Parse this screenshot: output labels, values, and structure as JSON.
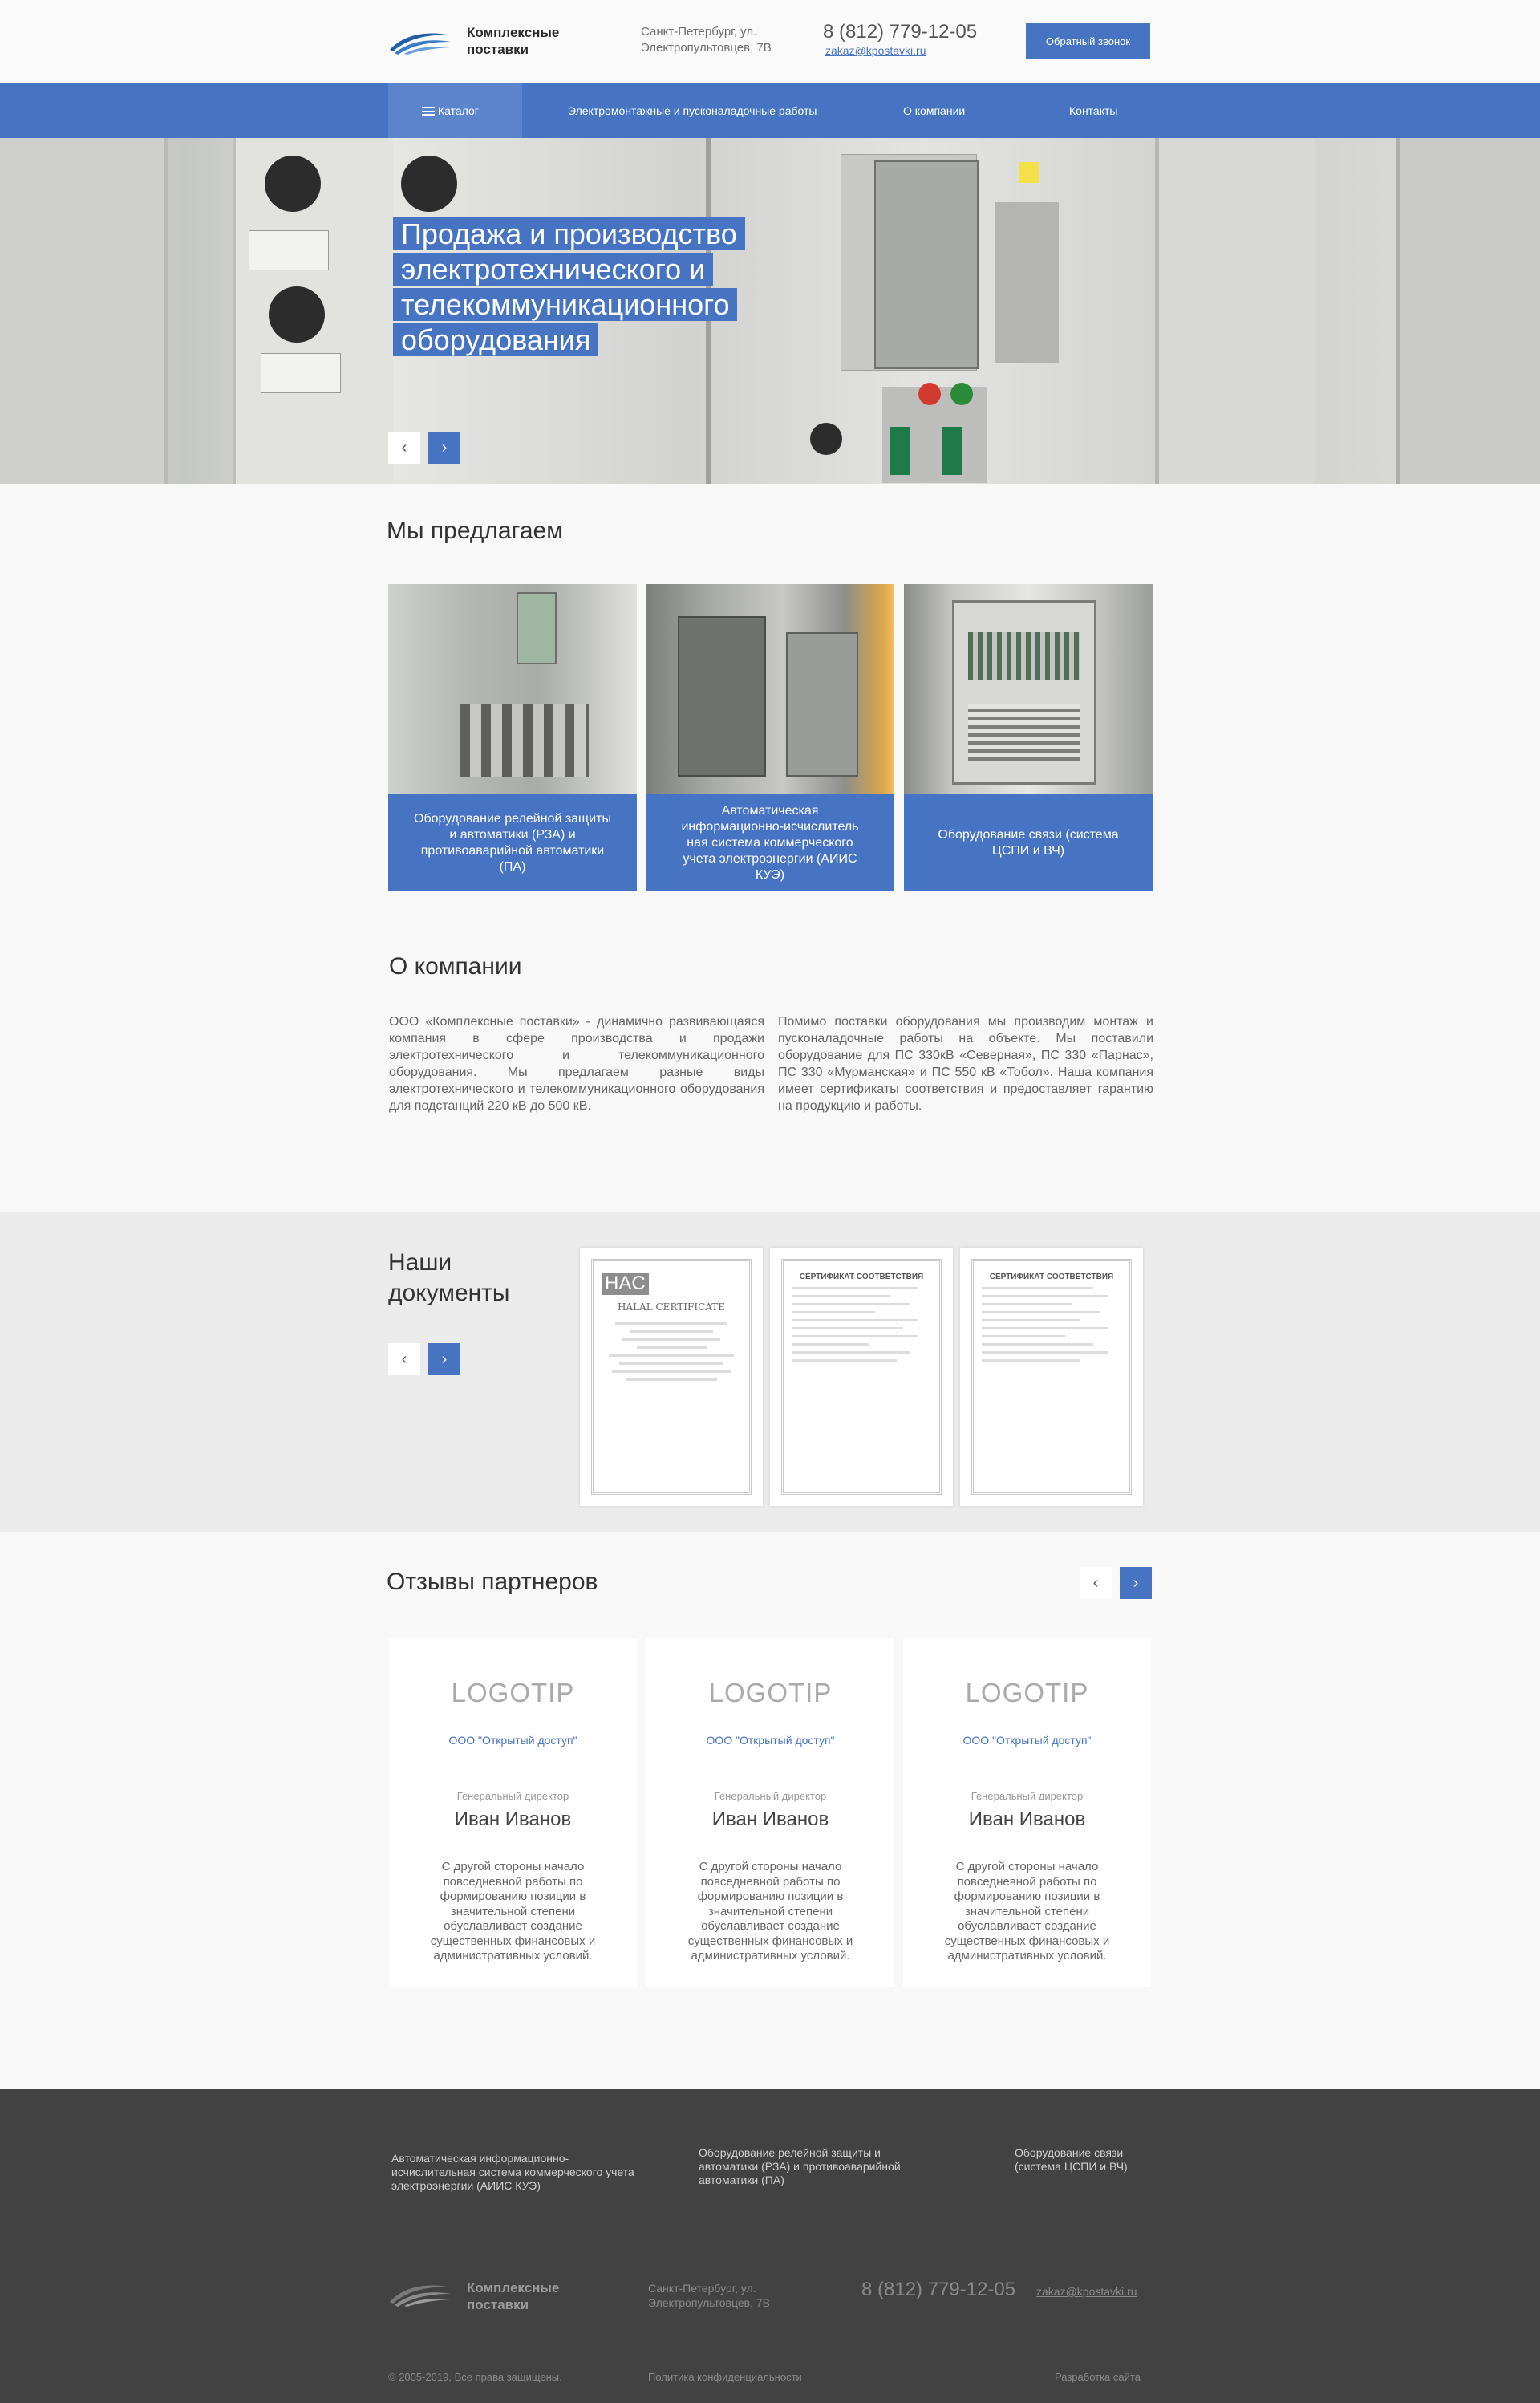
{
  "header": {
    "logo_name": "Комплексные поставки",
    "address": "Санкт-Петербург, ул. Электропультовцев, 7В",
    "phone": "8 (812) 779-12-05",
    "email": "zakaz@kpostavki.ru",
    "callback_label": "Обратный звонок"
  },
  "nav": {
    "catalog": "Каталог",
    "items": [
      "Электромонтажные и пусконаладочные работы",
      "О компании",
      "Контакты"
    ]
  },
  "hero": {
    "title_lines": [
      "Продажа и производство",
      "электротехнического и",
      "телекоммуникационного",
      "оборудования"
    ],
    "prev": "‹",
    "next": "›"
  },
  "offers": {
    "title": "Мы предлагаем",
    "items": [
      "Оборудование релейной защиты и автоматики (РЗА) и противоаварийной автоматики (ПА)",
      "Автоматическая информационно-исчислитель ная система коммерческого учета электроэнергии (АИИС КУЭ)",
      "Оборудование связи (системa ЦСПИ и ВЧ)"
    ]
  },
  "about": {
    "title": "О компании",
    "col1": "ООО «Комплексные поставки» - динамично развивающаяся компания в сфере производства и продажи электротехнического и телекоммуникационного оборудования. Мы предлагаем разные виды электротехнического и телекоммуникационного оборудования для подстанций 220 кВ до 500 кВ.",
    "col2": "Помимо поставки оборудования мы производим монтаж и пусконаладочные работы на объекте. Мы поставили оборудование для ПС 330кВ «Северная», ПС 330 «Парнас», ПС 330 «Мурманская» и ПС 550 кВ «Тобол». Наша компания имеет сертификаты соответствия и предоставляет гарантию на продукцию и работы."
  },
  "documents": {
    "title_line1": "Наши",
    "title_line2": "документы",
    "certs": [
      {
        "badge": "HAC",
        "heading": "HALAL CERTIFICATE"
      },
      {
        "badge": "",
        "heading": "СЕРТИФИКАТ СООТВЕТСТВИЯ"
      },
      {
        "badge": "",
        "heading": "СЕРТИФИКАТ СООТВЕТСТВИЯ"
      }
    ]
  },
  "reviews": {
    "title": "Отзывы партнеров",
    "items": [
      {
        "logo": "LOGOTIP",
        "company": "ООО \"Открытый доступ\"",
        "role": "Генеральный директор",
        "name": "Иван Иванов",
        "text": "С другой стороны начало повседневной работы по формированию позиции в значительной степени обуславливает создание существенных финансовых и административных условий."
      },
      {
        "logo": "LOGOTIP",
        "company": "ООО \"Открытый доступ\"",
        "role": "Генеральный директор",
        "name": "Иван Иванов",
        "text": "С другой стороны начало повседневной работы по формированию позиции в значительной степени обуславливает создание существенных финансовых и административных условий."
      },
      {
        "logo": "LOGOTIP",
        "company": "ООО \"Открытый доступ\"",
        "role": "Генеральный директор",
        "name": "Иван Иванов",
        "text": "С другой стороны начало повседневной работы по формированию позиции в значительной степени обуславливает создание существенных финансовых и административных условий."
      }
    ]
  },
  "footer": {
    "links": [
      "Автоматическая информационно-исчислительная система коммерческого учета электроэнергии (АИИС КУЭ)",
      "Оборудование релейной защиты и автоматики (РЗА) и противоаварийной автоматики (ПА)",
      "Оборудование связи (система ЦСПИ и ВЧ)"
    ],
    "logo_name": "Комплексные поставки",
    "address": "Санкт-Петербург, ул. Электропультовцев, 7В",
    "phone": "8 (812) 779-12-05",
    "email": "zakaz@kpostavki.ru",
    "copyright": "© 2005-2019, Все права защищены.",
    "policy": "Политика конфиденциальности",
    "dev": "Разработка сайта"
  },
  "colors": {
    "accent": "#4674c2",
    "footer_bg": "#424242"
  }
}
